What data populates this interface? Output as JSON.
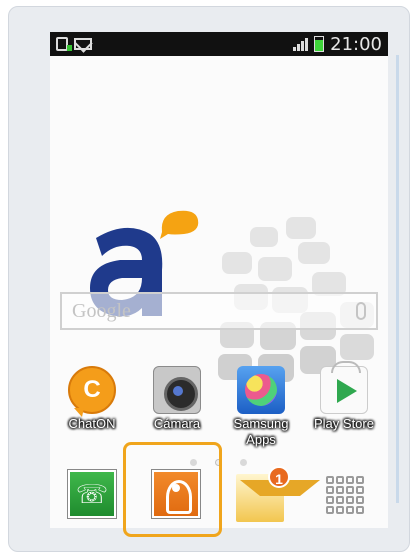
{
  "status_bar": {
    "left_icons": [
      "sim-card-icon",
      "mail-icon"
    ],
    "right_icons": [
      "signal-icon",
      "battery-icon"
    ],
    "time": "21:00"
  },
  "search": {
    "label": "Google",
    "icon": "mic-icon"
  },
  "apps": [
    {
      "label": "ChatON",
      "icon": "chaton-icon"
    },
    {
      "label": "Cámara",
      "icon": "camera-icon"
    },
    {
      "label": "Samsung Apps",
      "icon": "samsung-apps-icon"
    },
    {
      "label": "Play Store",
      "icon": "play-store-icon"
    }
  ],
  "dock": [
    {
      "icon": "phone-icon"
    },
    {
      "icon": "contacts-icon",
      "highlighted": true
    },
    {
      "icon": "messages-icon",
      "badge": "1"
    },
    {
      "icon": "apps-grid-icon"
    }
  ],
  "page_indicator": {
    "count": 3,
    "active": 2
  },
  "colors": {
    "highlight": "#f0a51c",
    "logo_blue": "#1f3a8c",
    "logo_orange": "#f5a312",
    "status_bar": "#111111",
    "badge": "#e86a1f"
  }
}
